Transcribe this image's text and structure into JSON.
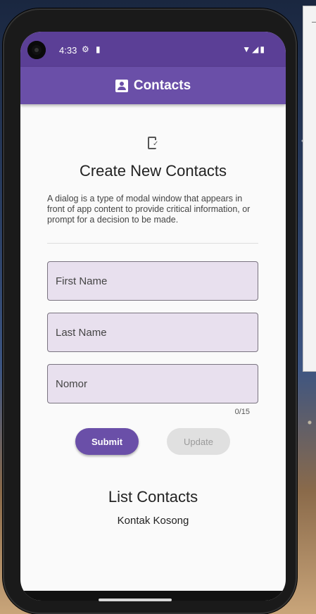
{
  "status": {
    "time": "4:33"
  },
  "appbar": {
    "title": "Contacts"
  },
  "form": {
    "heading": "Create New Contacts",
    "description": "A dialog is a type of modal window that appears in front of app content to provide critical information, or prompt for a decision to be made.",
    "first_name_placeholder": "First Name",
    "last_name_placeholder": "Last Name",
    "nomor_placeholder": "Nomor",
    "nomor_counter": "0/15",
    "submit_label": "Submit",
    "update_label": "Update"
  },
  "list": {
    "heading": "List Contacts",
    "empty_text": "Kontak Kosong"
  },
  "colors": {
    "primary": "#6a4fa8",
    "statusbar": "#5b3f96",
    "field_bg": "#e8e0ee"
  }
}
